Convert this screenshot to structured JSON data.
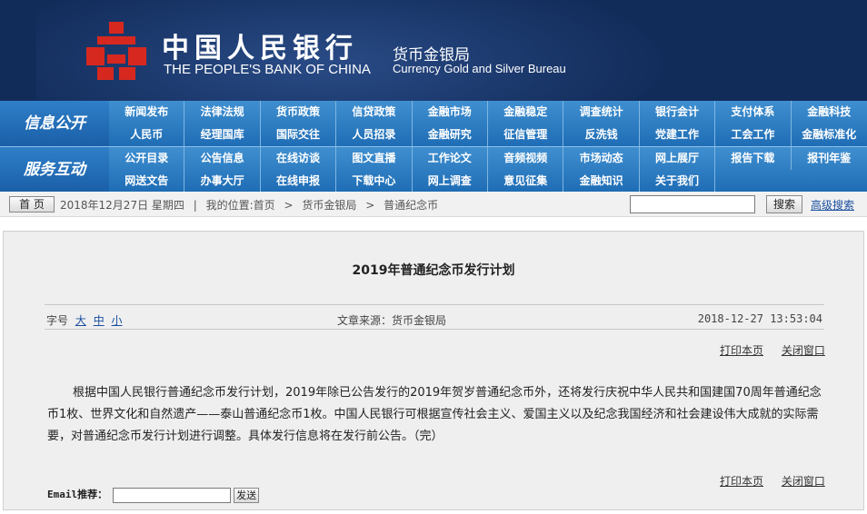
{
  "header": {
    "bank_name_cn": "中国人民银行",
    "bank_name_en": "THE PEOPLE'S BANK OF CHINA",
    "bureau_cn": "货币金银局",
    "bureau_en": "Currency  Gold and Silver Bureau",
    "bg_color": "#122c5a",
    "logo_color": "#d7281f"
  },
  "nav": {
    "info_label": "信息公开",
    "info_items": [
      "新闻发布",
      "法律法规",
      "货币政策",
      "信贷政策",
      "金融市场",
      "金融稳定",
      "调查统计",
      "银行会计",
      "支付体系",
      "金融科技",
      "人民币",
      "经理国库",
      "国际交往",
      "人员招录",
      "金融研究",
      "征信管理",
      "反洗钱",
      "党建工作",
      "工会工作",
      "金融标准化"
    ],
    "service_label": "服务互动",
    "service_items": [
      "公开目录",
      "公告信息",
      "在线访谈",
      "图文直播",
      "工作论文",
      "音频视频",
      "市场动态",
      "网上展厅",
      "报告下载",
      "报刊年鉴",
      "网送文告",
      "办事大厅",
      "在线申报",
      "下载中心",
      "网上调查",
      "意见征集",
      "金融知识",
      "关于我们"
    ],
    "color_top": "#3f8fd0",
    "color_bottom": "#1f6db5"
  },
  "breadcrumb": {
    "home_button": "首 页",
    "date": "2018年12月27日 星期四",
    "location_label": "我的位置:首页",
    "sep": ">",
    "level1": "货币金银局",
    "level2": "普通纪念币",
    "search_button": "搜索",
    "advanced_search": "高级搜索"
  },
  "article": {
    "title": "2019年普通纪念币发行计划",
    "font_size_label": "字号",
    "font_large": "大",
    "font_medium": "中",
    "font_small": "小",
    "source": "文章来源：货币金银局",
    "datetime": "2018-12-27 13:53:04",
    "print_link": "打印本页",
    "close_link": "关闭窗口",
    "body": "根据中国人民银行普通纪念币发行计划，2019年除已公告发行的2019年贺岁普通纪念币外，还将发行庆祝中华人民共和国建国70周年普通纪念币1枚、世界文化和自然遗产——泰山普通纪念币1枚。中国人民银行可根据宣传社会主义、爱国主义以及纪念我国经济和社会建设伟大成就的实际需要，对普通纪念币发行计划进行调整。具体发行信息将在发行前公告。（完）",
    "email_label": "Email推荐：",
    "send_button": "发送"
  }
}
